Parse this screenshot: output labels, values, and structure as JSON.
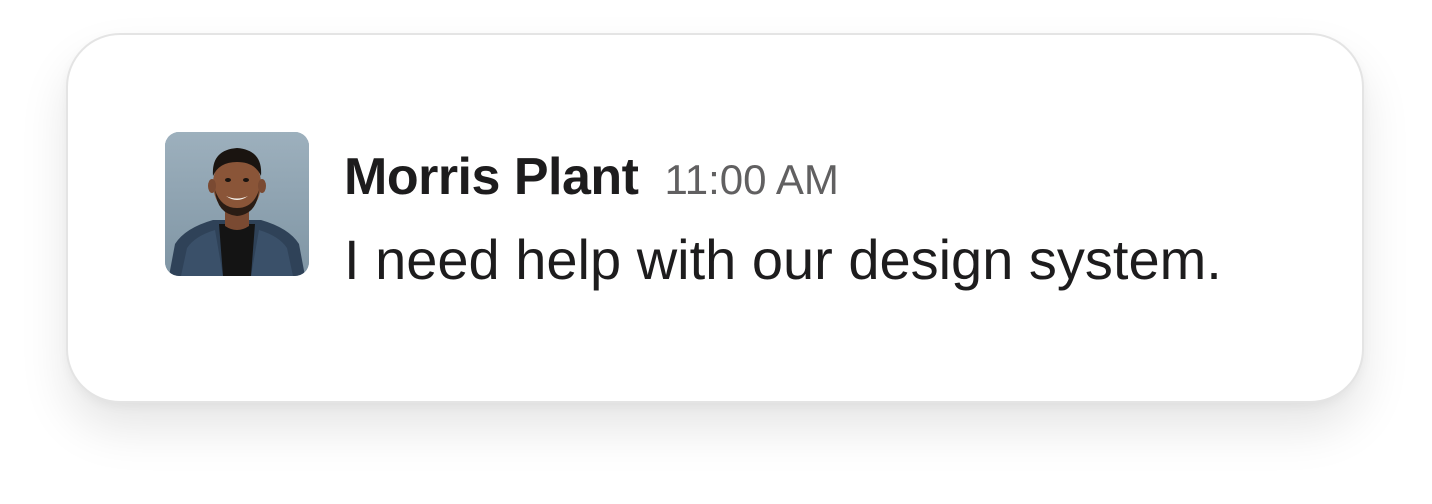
{
  "message": {
    "sender_name": "Morris Plant",
    "timestamp": "11:00 AM",
    "text": "I need help with our design system."
  },
  "avatar": {
    "alt": "Morris Plant"
  }
}
